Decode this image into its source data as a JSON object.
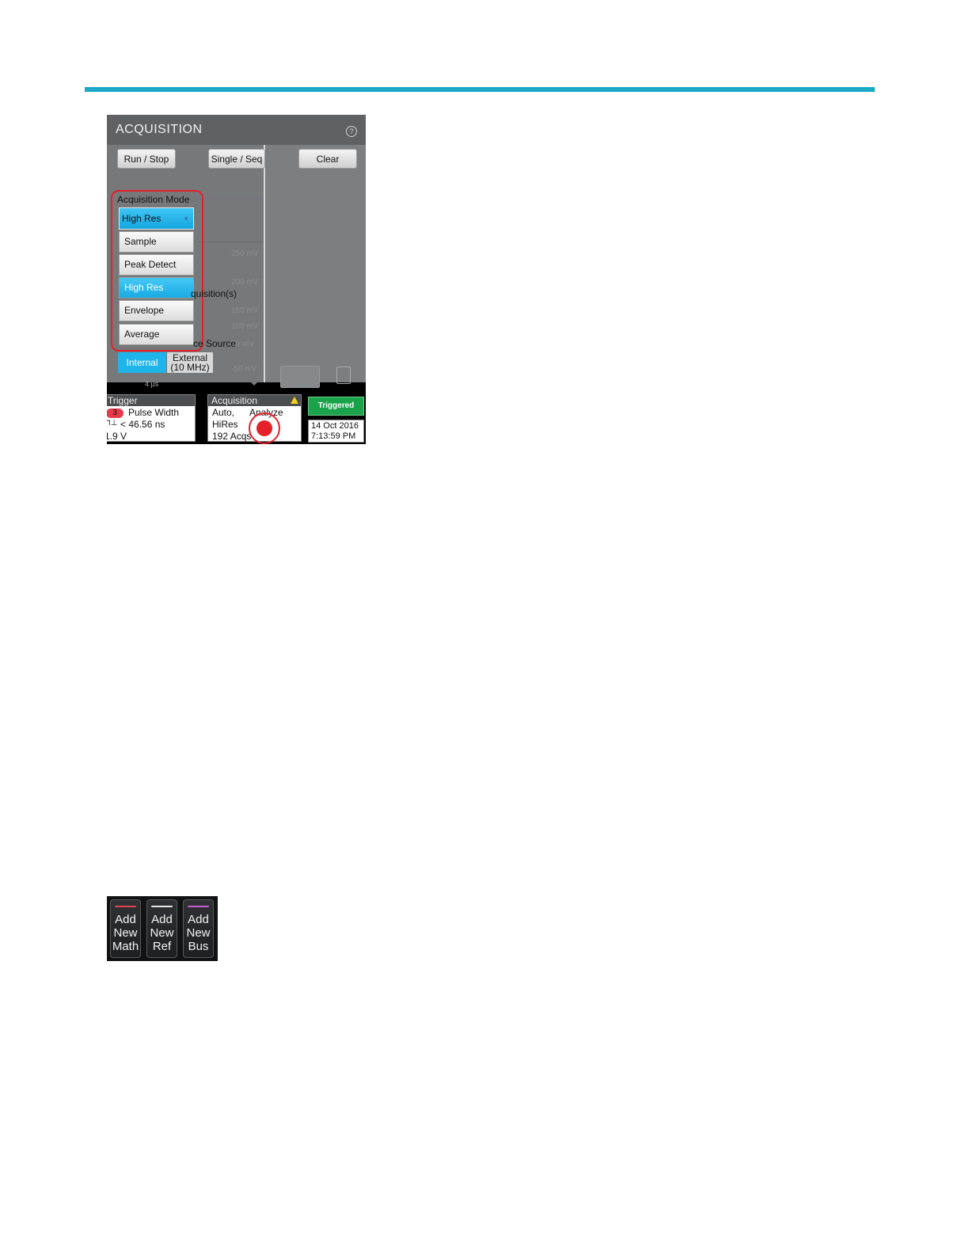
{
  "accent_color": "#19a9c6",
  "acquisition_panel": {
    "title": "ACQUISITION",
    "help_icon": "?",
    "buttons": {
      "run_stop": "Run / Stop",
      "single_seq": "Single / Seq",
      "clear": "Clear"
    },
    "mode_label": "Acquisition Mode",
    "mode_selected": "High Res",
    "mode_options": [
      "Sample",
      "Peak Detect",
      "High Res",
      "Envelope",
      "Average"
    ],
    "partial_label_acquisitions": "quisition(s)",
    "partial_label_source": "ce Source",
    "ref_source_internal": "Internal",
    "ref_source_external": "External",
    "ref_source_external_freq": "(10 MHz)",
    "ghost_scale": [
      "250 mV",
      "200 mV",
      "150 mV",
      "100 mV",
      "50 mV",
      "-50 mV"
    ],
    "timescale": "4 µs"
  },
  "status_bar": {
    "trigger": {
      "title": "Trigger",
      "channel": "3",
      "type": "Pulse Width",
      "condition": "< 46.56 ns",
      "level": "1.9 V",
      "slope_glyph": "⊓⊥"
    },
    "acquisition": {
      "title": "Acquisition",
      "mode_line": "Auto,",
      "analyze": "Analyze",
      "resolution": "HiRes",
      "count": "192 Acqs"
    },
    "triggered": "Triggered",
    "date": "14 Oct 2016",
    "time": "7:13:59 PM"
  },
  "add_buttons": [
    {
      "line1": "Add",
      "line2": "New",
      "line3": "Math",
      "color": "#e0454e"
    },
    {
      "line1": "Add",
      "line2": "New",
      "line3": "Ref",
      "color": "#e8e8e8"
    },
    {
      "line1": "Add",
      "line2": "New",
      "line3": "Bus",
      "color": "#c55bd6"
    }
  ]
}
